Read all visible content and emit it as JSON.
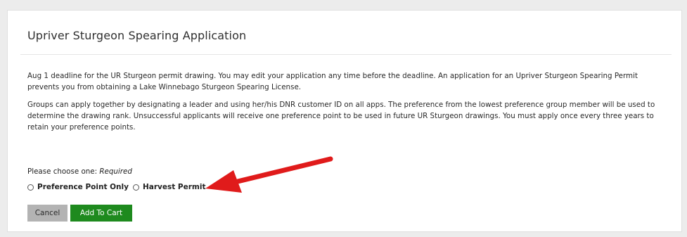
{
  "form": {
    "title": "Upriver Sturgeon Spearing Application",
    "paragraph1": "Aug 1 deadline for the UR Sturgeon permit drawing. You may edit your application any time before the deadline. An application for an Upriver Sturgeon Spearing Permit prevents you from obtaining a Lake Winnebago Sturgeon Spearing License.",
    "paragraph2": "Groups can apply together by designating a leader and using her/his DNR customer ID on all apps. The preference from the lowest preference group member will be used to determine the drawing rank. Unsuccessful applicants will receive one preference point to be used in future UR Sturgeon drawings. You must apply once every three years to retain your preference points.",
    "choose_label": "Please choose one:",
    "required_label": "Required",
    "options": [
      {
        "label": "Preference Point Only",
        "selected": false
      },
      {
        "label": "Harvest Permit",
        "selected": false
      }
    ],
    "cancel_label": "Cancel",
    "add_to_cart_label": "Add To Cart"
  },
  "colors": {
    "page_background": "#ececec",
    "card_background": "#ffffff",
    "cancel_button": "#b3b3b3",
    "add_to_cart_button": "#1e8a1e",
    "annotation_arrow": "#e01b1b"
  },
  "annotation": {
    "icon": "red-arrow-icon",
    "points_to": "Harvest Permit"
  }
}
